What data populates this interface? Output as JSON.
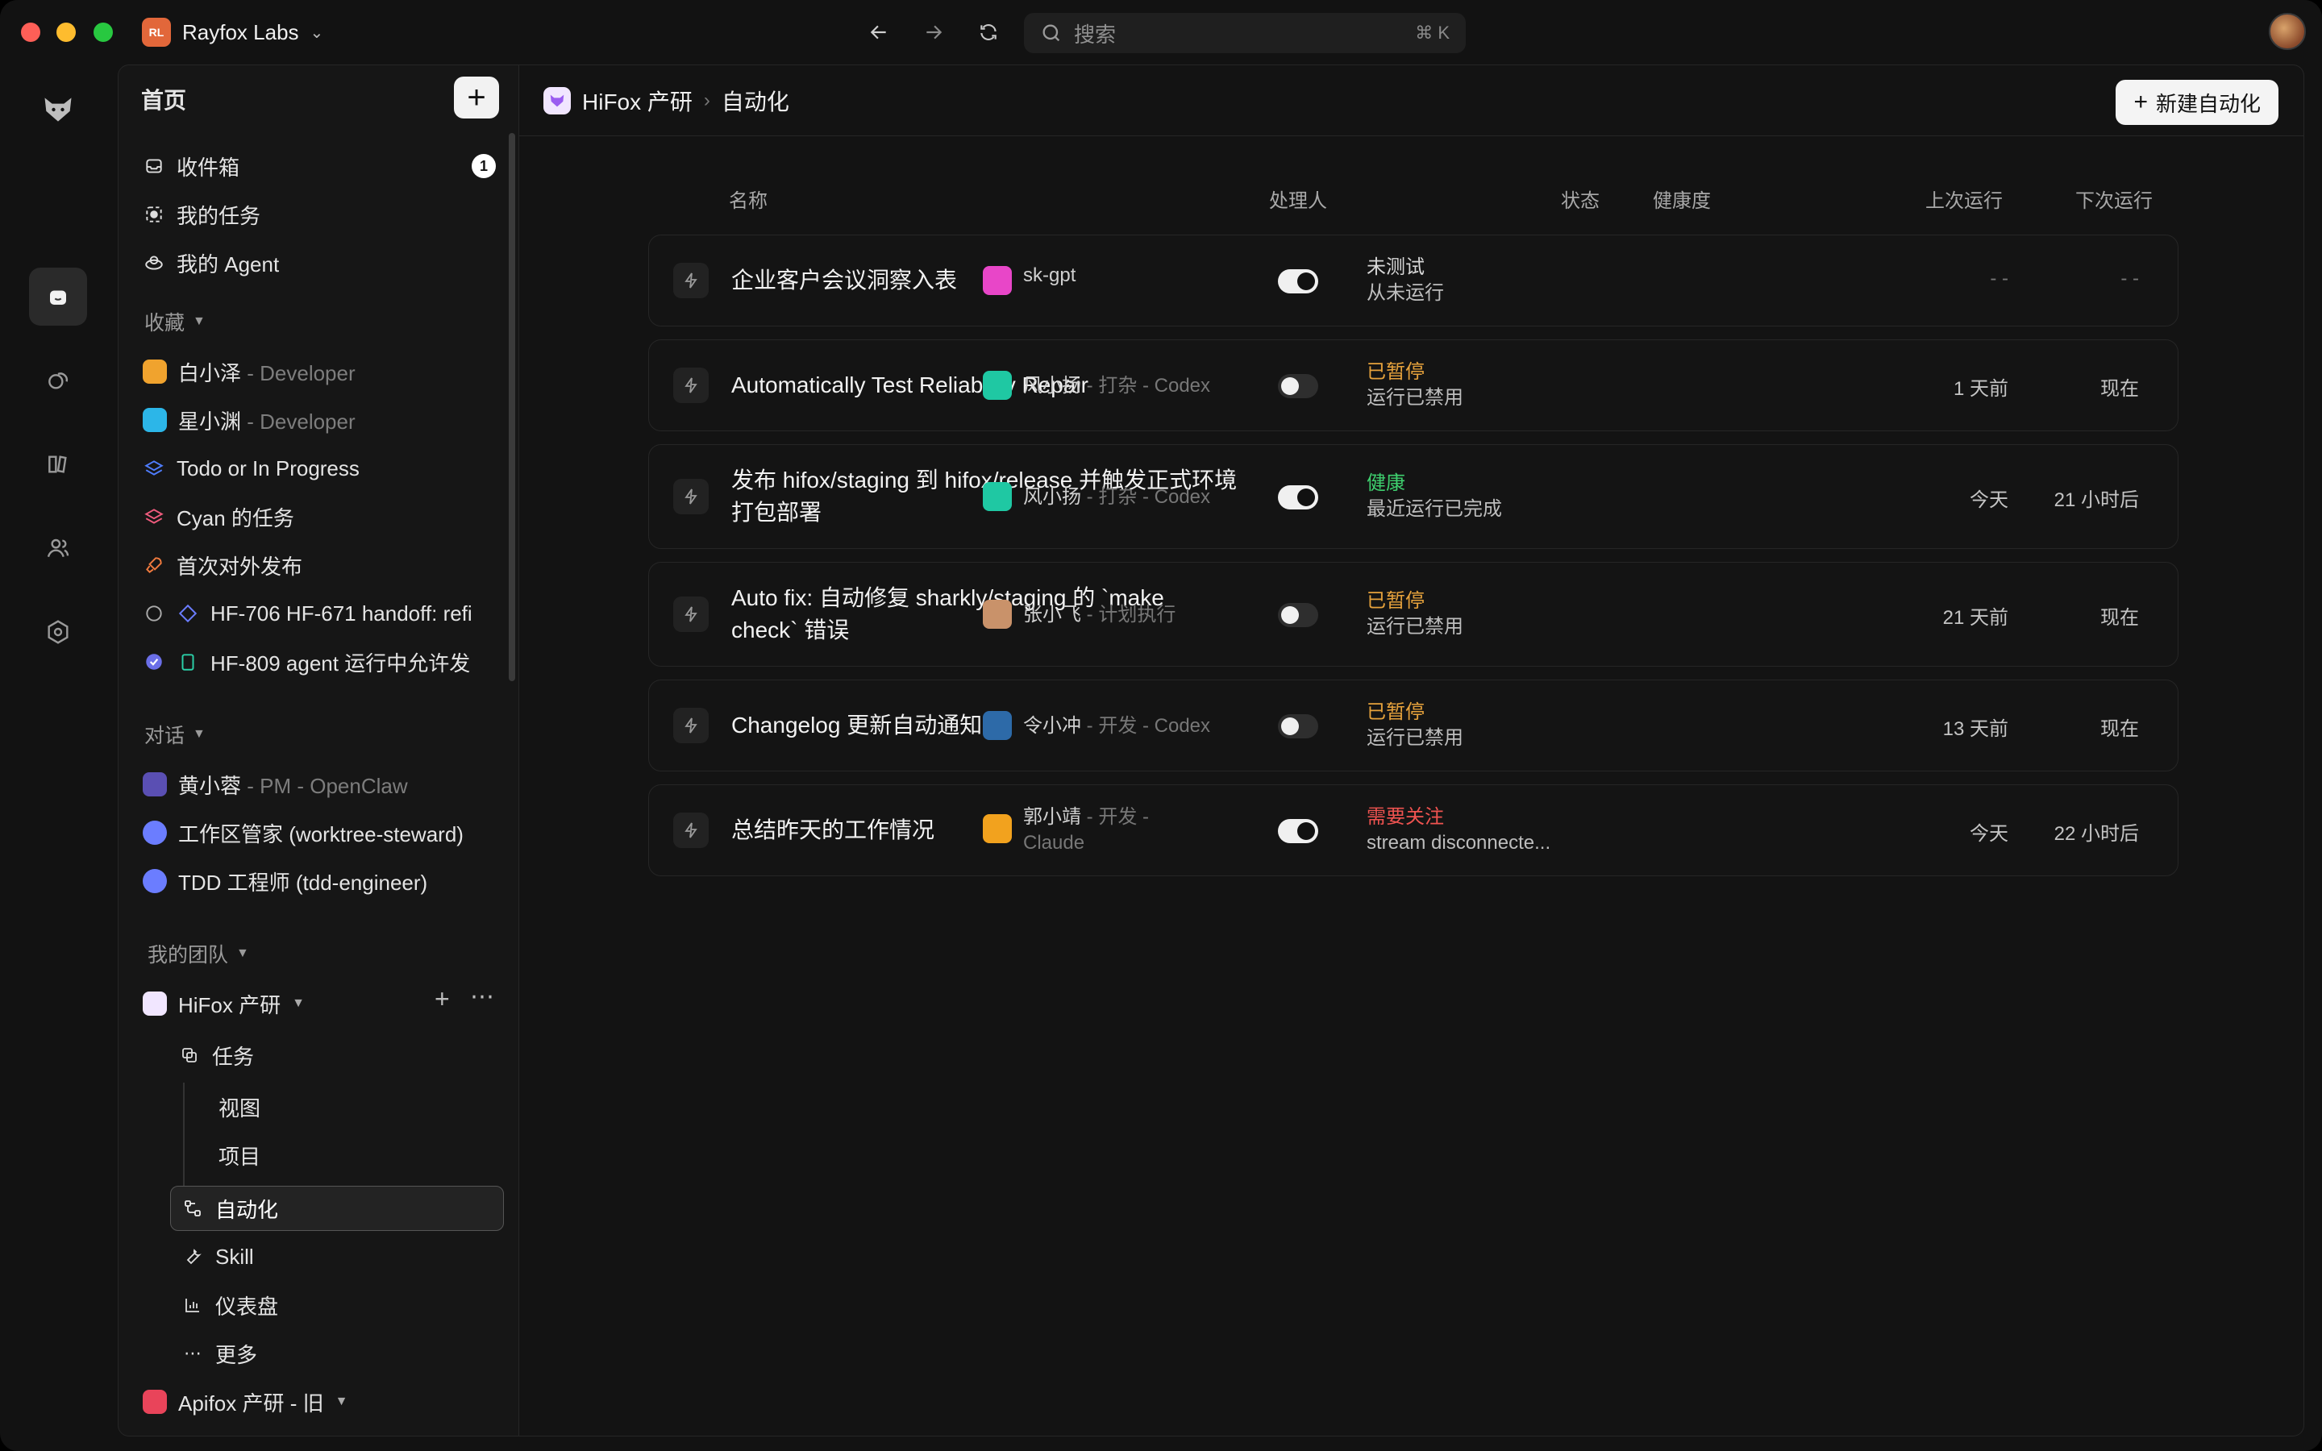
{
  "app": {
    "workspace_initials": "RL",
    "workspace_name": "Rayfox Labs",
    "search_placeholder": "搜索",
    "search_shortcut": "⌘ K"
  },
  "sidebar": {
    "title": "首页",
    "top_items": [
      {
        "label": "收件箱",
        "icon": "inbox-icon",
        "badge": "1"
      },
      {
        "label": "我的任务",
        "icon": "tasks-icon"
      },
      {
        "label": "我的 Agent",
        "icon": "agent-icon"
      }
    ],
    "favorites_label": "收藏",
    "favorites": [
      {
        "label": "白小泽",
        "suffix": " - Developer"
      },
      {
        "label": "星小渊",
        "suffix": " - Developer"
      },
      {
        "label": "Todo or In Progress",
        "suffix": ""
      },
      {
        "label": "Cyan 的任务",
        "suffix": ""
      },
      {
        "label": "首次对外发布",
        "suffix": ""
      },
      {
        "label": "HF-706 HF-671 handoff: refi",
        "suffix": ""
      },
      {
        "label": "HF-809 agent 运行中允许发",
        "suffix": ""
      }
    ],
    "chats_label": "对话",
    "chats": [
      {
        "label": "黄小蓉",
        "suffix": " - PM - OpenClaw"
      },
      {
        "label": "工作区管家 (worktree-steward)",
        "suffix": ""
      },
      {
        "label": "TDD 工程师 (tdd-engineer)",
        "suffix": ""
      }
    ],
    "teams_label": "我的团队",
    "team_name": "HiFox 产研",
    "team_nav": [
      {
        "label": "任务"
      },
      {
        "label": "视图"
      },
      {
        "label": "项目"
      },
      {
        "label": "自动化"
      },
      {
        "label": "Skill"
      },
      {
        "label": "仪表盘"
      },
      {
        "label": "更多"
      }
    ],
    "other_team": "Apifox 产研 - 旧"
  },
  "main": {
    "breadcrumb_team": "HiFox 产研",
    "breadcrumb_page": "自动化",
    "new_button": "新建自动化",
    "columns": {
      "name": "名称",
      "assignee": "处理人",
      "status": "状态",
      "health": "健康度",
      "last_run": "上次运行",
      "next_run": "下次运行"
    },
    "rows": [
      {
        "name": "企业客户会议洞察入表",
        "assignee": "sk-gpt",
        "role": "",
        "enabled": true,
        "health": "未测试",
        "health_color": "#d8d8d8",
        "health_sub": "从未运行",
        "last": "- -",
        "next": "- -"
      },
      {
        "name": "Automatically Test Reliability Repair",
        "assignee": "风小扬",
        "role": " - 打杂 - Codex",
        "enabled": false,
        "health": "已暂停",
        "health_color": "#e6a23c",
        "health_sub": "运行已禁用",
        "last": "1 天前",
        "next": "现在"
      },
      {
        "name": "发布 hifox/staging 到 hifox/release 并触发正式环境打包部署",
        "assignee": "风小扬",
        "role": " - 打杂 - Codex",
        "enabled": true,
        "health": "健康",
        "health_color": "#3ecf6e",
        "health_sub": "最近运行已完成",
        "last": "今天",
        "next": "21 小时后"
      },
      {
        "name": "Auto fix: 自动修复 sharkly/staging 的 `make check` 错误",
        "assignee": "张小飞",
        "role": " - 计划执行",
        "enabled": false,
        "health": "已暂停",
        "health_color": "#e6a23c",
        "health_sub": "运行已禁用",
        "last": "21 天前",
        "next": "现在"
      },
      {
        "name": "Changelog 更新自动通知",
        "assignee": "令小冲",
        "role": " - 开发 - Codex",
        "enabled": false,
        "health": "已暂停",
        "health_color": "#e6a23c",
        "health_sub": "运行已禁用",
        "last": "13 天前",
        "next": "现在"
      },
      {
        "name": "总结昨天的工作情况",
        "assignee": "郭小靖",
        "role": " - 开发 -",
        "role2": "Claude",
        "enabled": true,
        "health": "需要关注",
        "health_color": "#ef5350",
        "health_sub": "stream disconnecte...",
        "last": "今天",
        "next": "22 小时后"
      }
    ]
  }
}
